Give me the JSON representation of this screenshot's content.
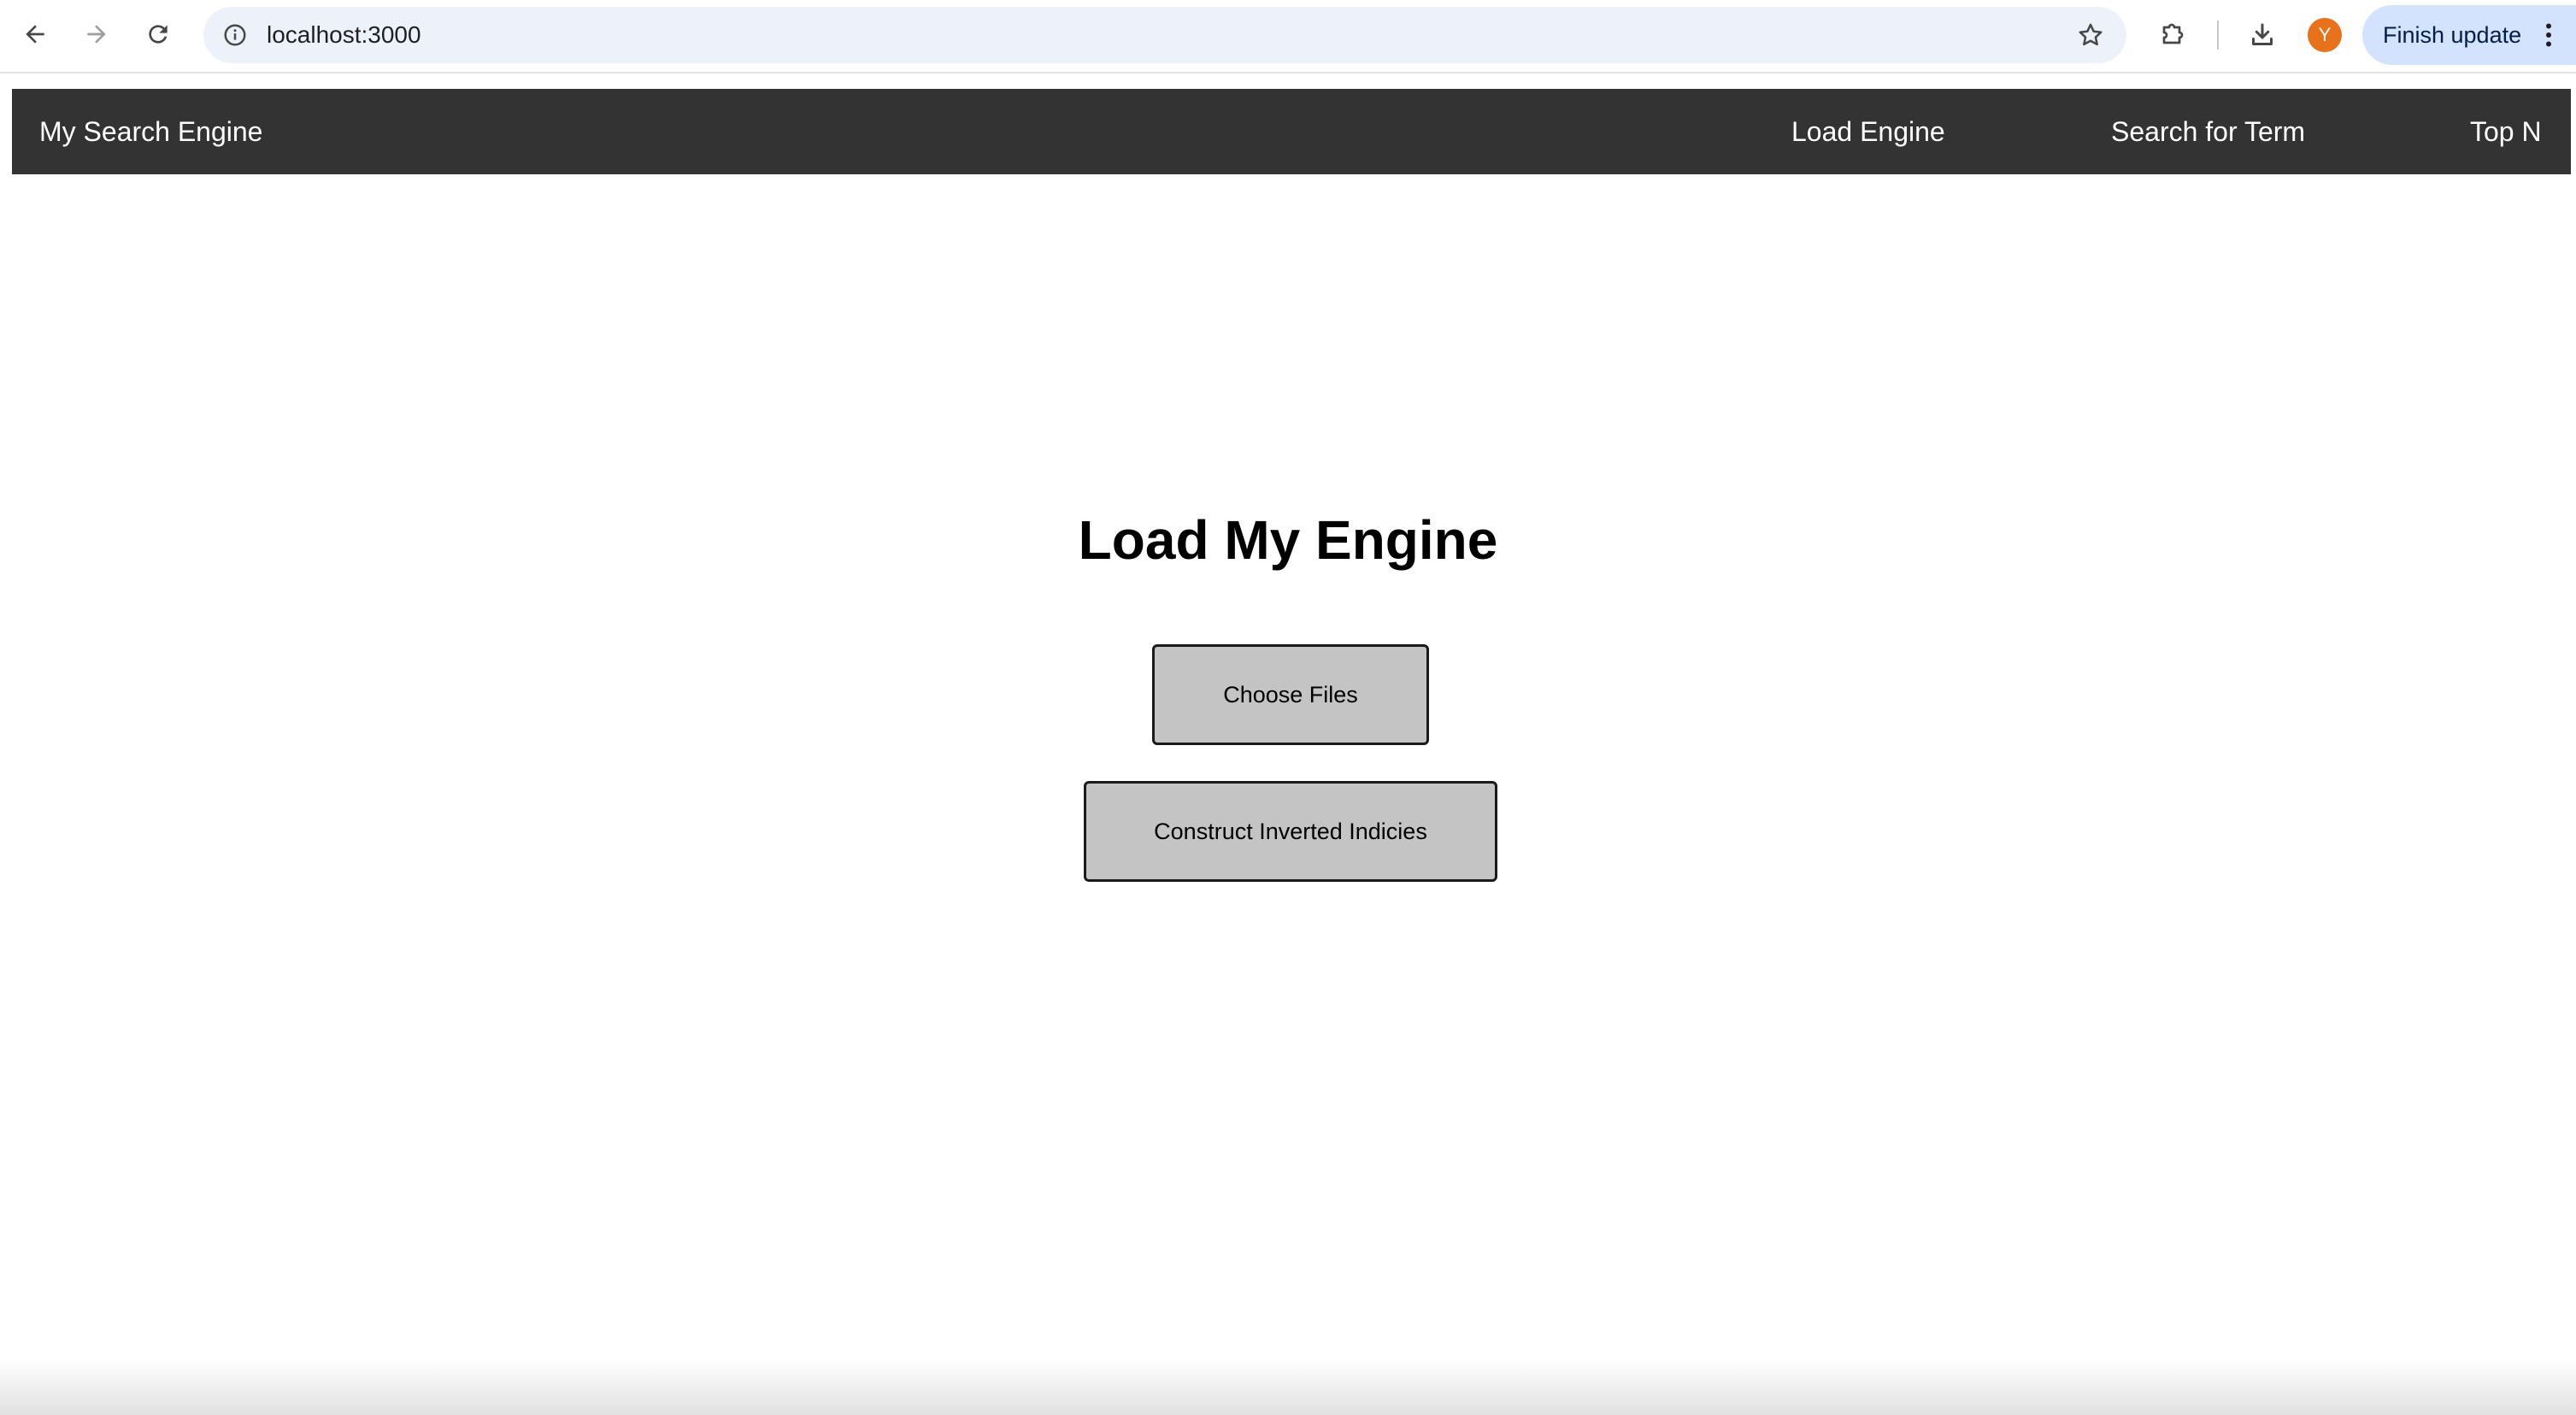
{
  "browser": {
    "url": "localhost:3000",
    "avatar_initial": "Y",
    "update_label": "Finish update",
    "icons": {
      "back": "back-arrow-icon",
      "forward": "forward-arrow-icon",
      "reload": "reload-icon",
      "site_info": "info-icon",
      "bookmark": "star-icon",
      "extensions": "puzzle-icon",
      "downloads": "download-icon",
      "menu": "kebab-menu-icon"
    }
  },
  "navbar": {
    "brand": "My Search Engine",
    "links": [
      "Load Engine",
      "Search for Term",
      "Top N"
    ],
    "background": "#333333",
    "text_color": "#ffffff"
  },
  "main": {
    "title": "Load My Engine",
    "choose_files_label": "Choose Files",
    "construct_label": "Construct Inverted Indicies",
    "button_color": "#c4c4c4"
  }
}
